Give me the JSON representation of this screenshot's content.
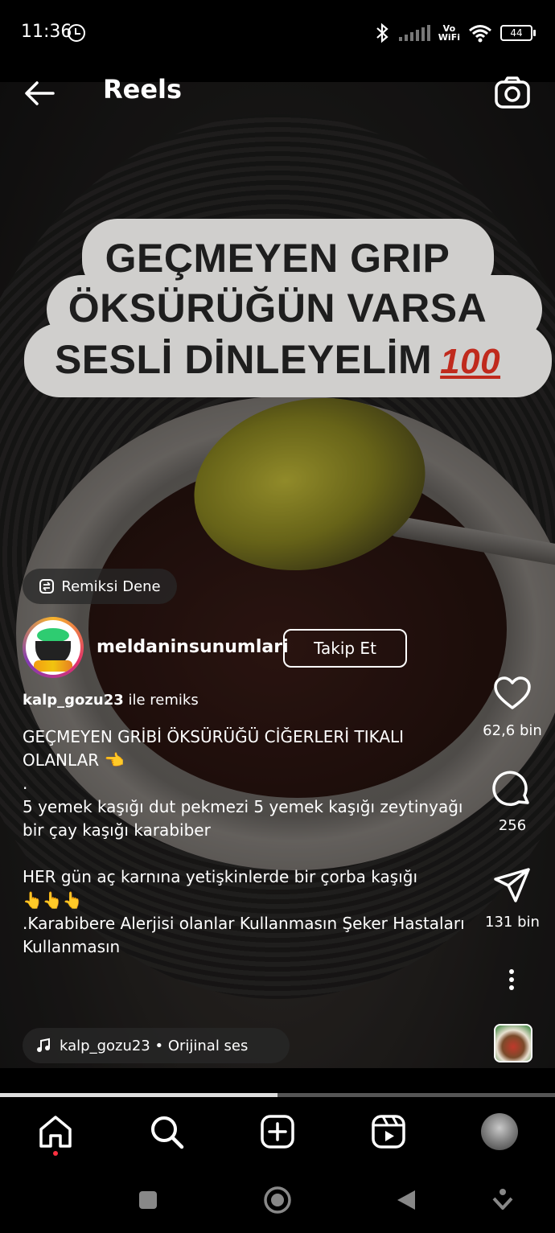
{
  "status_bar": {
    "time": "11:36",
    "vowifi_line1": "Vo",
    "vowifi_line2": "WiFi",
    "battery": "44"
  },
  "header": {
    "title": "Reels"
  },
  "video": {
    "overlay_lines": [
      "GEÇMEYEN GRIP",
      "ÖKSÜRÜĞÜN VARSA",
      "SESLİ DİNLEYELİM"
    ],
    "overlay_emoji": "100"
  },
  "remix_chip": {
    "label": "Remiksi Dene"
  },
  "author": {
    "username": "meldaninsunumlari",
    "follow_label": "Takip Et"
  },
  "remix_with": {
    "user": "kalp_gozu23",
    "suffix": "ile remiks"
  },
  "description": "GEÇMEYEN GRİBİ ÖKSÜRÜĞÜ CİĞERLERİ TIKALI OLANLAR 👈\n.\n5 yemek kaşığı dut pekmezi 5 yemek kaşığı zeytinyağı bir çay kaşığı karabiber\n\nHER gün aç karnına yetişkinlerde bir çorba kaşığı\n👆👆👆\n.Karabibere Alerjisi olanlar Kullanmasın Şeker Hastaları Kullanmasın",
  "actions": {
    "likes": "62,6 bin",
    "comments": "256",
    "shares": "131 bin"
  },
  "audio": {
    "label": "kalp_gozu23 • Orijinal ses"
  },
  "progress": {
    "played_fraction": 0.5
  },
  "icons": {
    "back": "arrow-left-icon",
    "camera": "camera-icon",
    "heart": "heart-icon",
    "comment": "comment-icon",
    "share": "share-icon",
    "more": "more-vertical-icon",
    "music": "music-note-icon",
    "home": "home-icon",
    "search": "search-icon",
    "create": "plus-square-icon",
    "reels": "reels-icon"
  },
  "colors": {
    "background": "#000000",
    "text": "#ffffff",
    "notification_dot": "#ff3040",
    "overlay_bubble": "#d0cfcd",
    "emoji_red": "#c02a1d"
  }
}
